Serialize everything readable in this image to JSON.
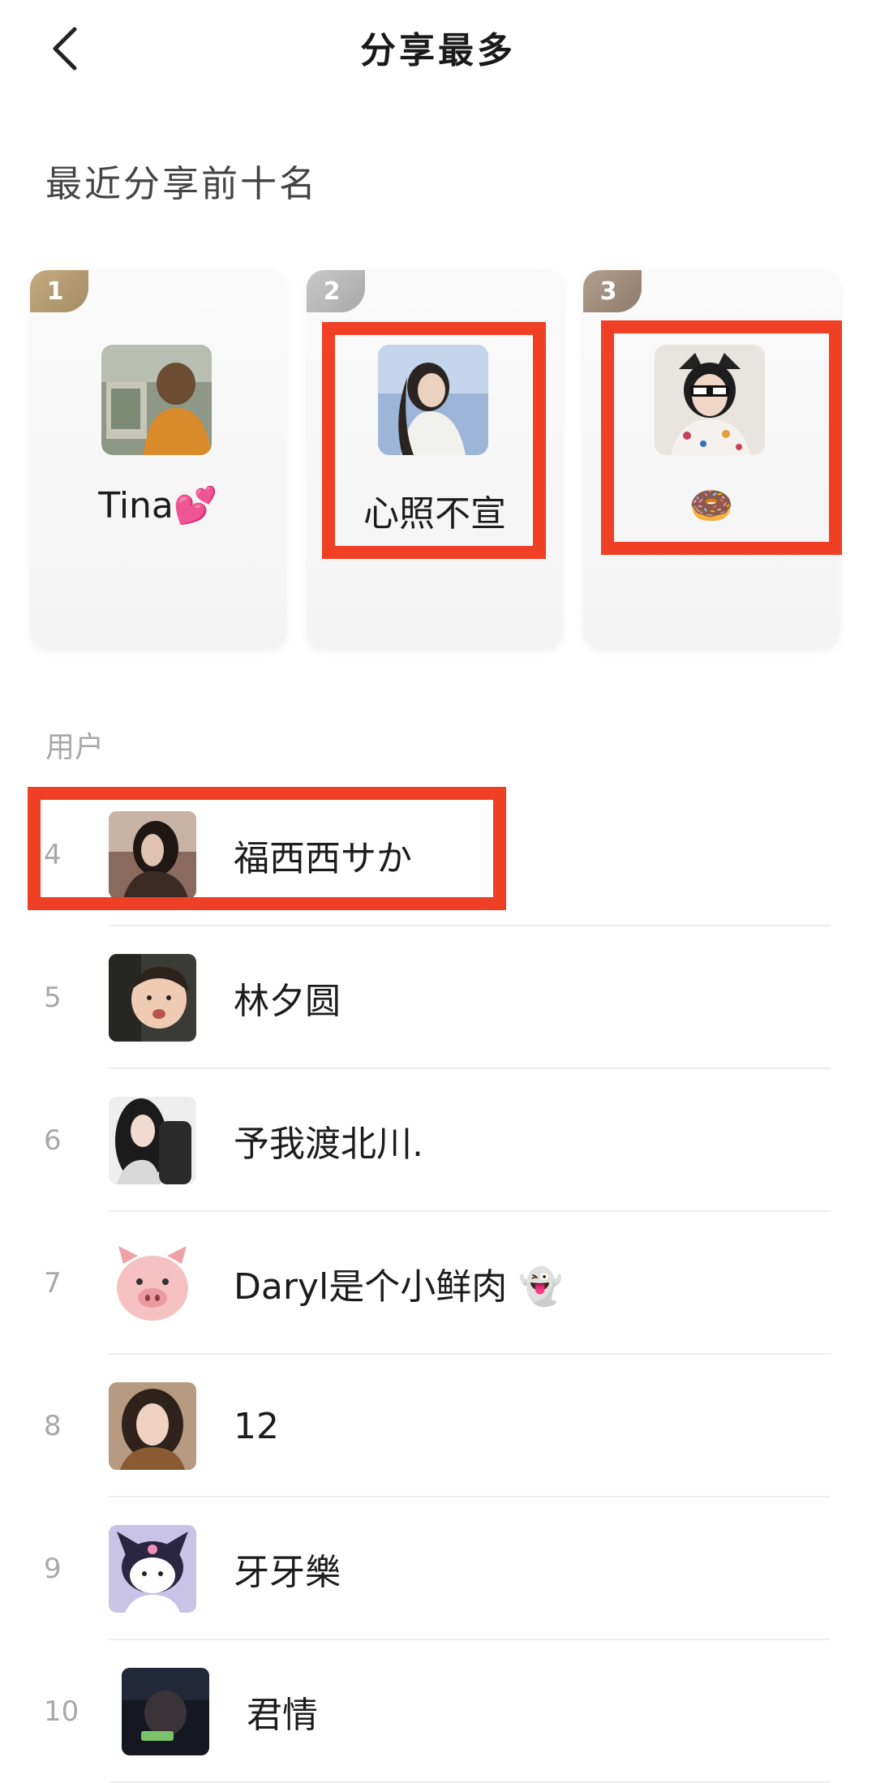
{
  "header": {
    "title": "分享最多",
    "back_icon": "chevron-left-icon"
  },
  "section_title": "最近分享前十名",
  "top3": [
    {
      "rank": "1",
      "name": "Tina💕",
      "badge_color": "#b29a70"
    },
    {
      "rank": "2",
      "name": "心照不宣",
      "badge_color": "#b8b8b8"
    },
    {
      "rank": "3",
      "name": "🍩",
      "badge_color": "#9f8b7a"
    }
  ],
  "users_label": "用户",
  "users": [
    {
      "rank": "4",
      "name": "福西西サか"
    },
    {
      "rank": "5",
      "name": "林夕圆"
    },
    {
      "rank": "6",
      "name": "予我渡北川."
    },
    {
      "rank": "7",
      "name": "Daryl是个小鲜肉 👻"
    },
    {
      "rank": "8",
      "name": "12"
    },
    {
      "rank": "9",
      "name": "牙牙樂"
    },
    {
      "rank": "10",
      "name": "君情"
    }
  ],
  "highlight_color": "#ef3f24"
}
